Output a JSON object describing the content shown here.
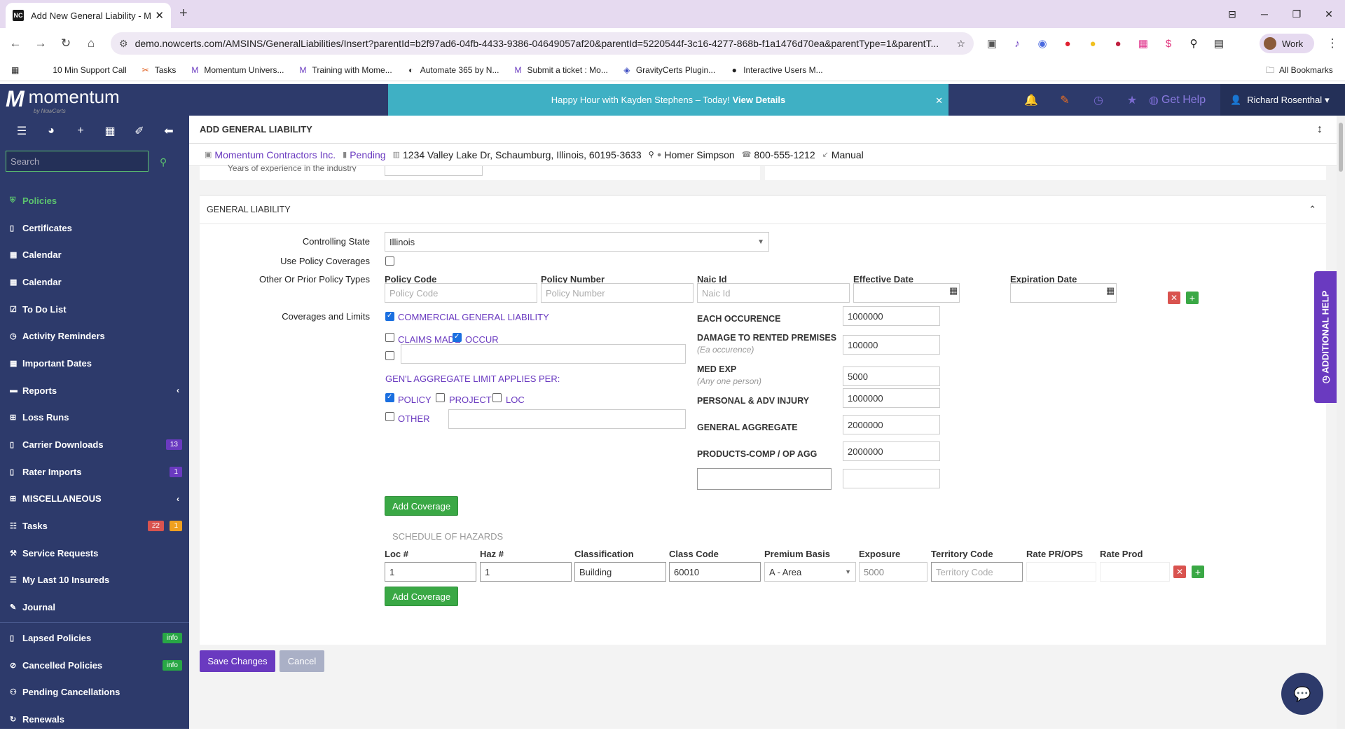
{
  "browser": {
    "tab_title": "Add New General Liability - Mo",
    "tab_icon": "NC",
    "url": "demo.nowcerts.com/AMSINS/GeneralLiabilities/Insert?parentId=b2f97ad6-04fb-4433-9386-04649057af20&parentId=5220544f-3c16-4277-868b-f1a1476d70ea&parentType=1&parentT...",
    "profile_label": "Work",
    "bookmarks": [
      "10 Min Support Call",
      "Tasks",
      "Momentum Univers...",
      "Training with Mome...",
      "Automate 365 by N...",
      "Submit a ticket : Mo...",
      "GravityCerts Plugin...",
      "Interactive Users M..."
    ],
    "all_bookmarks": "All Bookmarks"
  },
  "header": {
    "logo_text": "momentum",
    "logo_sub": "by NowCerts",
    "promo_text": "Happy Hour with Kayden Stephens – Today!",
    "promo_link": "View Details",
    "get_help": "Get Help",
    "user_name": "Richard Rosenthal"
  },
  "sidebar": {
    "search_placeholder": "Search",
    "items": [
      {
        "label": "Policies",
        "icon": "shield-icon",
        "active": true
      },
      {
        "label": "Certificates",
        "icon": "file-icon"
      },
      {
        "label": "Calendar",
        "icon": "calendar-icon"
      },
      {
        "label": "Calendar",
        "icon": "calendar-icon"
      },
      {
        "label": "To Do List",
        "icon": "checklist-icon"
      },
      {
        "label": "Activity Reminders",
        "icon": "clock-icon"
      },
      {
        "label": "Important Dates",
        "icon": "calendar-icon"
      },
      {
        "label": "Reports",
        "icon": "folder-icon"
      },
      {
        "label": "Loss Runs",
        "icon": "grid-icon"
      },
      {
        "label": "Carrier Downloads",
        "icon": "file-icon",
        "badge": "13"
      },
      {
        "label": "Rater Imports",
        "icon": "file-icon",
        "badge": "1"
      },
      {
        "label": "MISCELLANEOUS",
        "icon": "grid-icon"
      },
      {
        "label": "Tasks",
        "icon": "tasks-icon",
        "badge_red": "22",
        "badge_orange": "1"
      },
      {
        "label": "Service Requests",
        "icon": "wrench-icon"
      },
      {
        "label": "My Last 10 Insureds",
        "icon": "list-icon"
      },
      {
        "label": "Journal",
        "icon": "pencil-icon"
      },
      {
        "label": "Lapsed Policies",
        "icon": "file-icon",
        "badge_info": "info"
      },
      {
        "label": "Cancelled Policies",
        "icon": "ban-icon",
        "badge_info": "info"
      },
      {
        "label": "Pending Cancellations",
        "icon": "users-icon"
      },
      {
        "label": "Renewals",
        "icon": "refresh-icon"
      }
    ]
  },
  "page": {
    "title": "ADD GENERAL LIABILITY",
    "insured": "Momentum Contractors Inc.",
    "status": "Pending",
    "address": "1234 Valley Lake Dr, Schaumburg, Illinois, 60195-3633",
    "contact": "Homer Simpson",
    "phone": "800-555-1212",
    "source": "Manual",
    "prev_label": "Years of experience in the industry"
  },
  "gl": {
    "section_title": "GENERAL LIABILITY",
    "controlling_state_label": "Controlling State",
    "controlling_state": "Illinois",
    "use_policy_coverages_label": "Use Policy Coverages",
    "other_prior_label": "Other Or Prior Policy Types",
    "policy_code_label": "Policy Code",
    "policy_code_ph": "Policy Code",
    "policy_number_label": "Policy Number",
    "policy_number_ph": "Policy Number",
    "naic_label": "Naic Id",
    "naic_ph": "Naic Id",
    "eff_date_label": "Effective Date",
    "exp_date_label": "Expiration Date",
    "coverages_label": "Coverages and Limits",
    "cgl": "COMMERCIAL GENERAL LIABILITY",
    "claims_made": "CLAIMS MADE",
    "occur": "OCCUR",
    "agg_applies": "GEN'L AGGREGATE LIMIT APPLIES PER:",
    "policy": "POLICY",
    "project": "PROJECT",
    "loc": "LOC",
    "other": "OTHER",
    "each_occ": "EACH OCCURENCE",
    "each_occ_val": "1000000",
    "damage": "DAMAGE TO RENTED PREMISES",
    "damage_sub": "(Ea occurence)",
    "damage_val": "100000",
    "med": "MED EXP",
    "med_sub": "(Any one person)",
    "med_val": "5000",
    "personal": "PERSONAL & ADV INJURY",
    "personal_val": "1000000",
    "gen_agg": "GENERAL AGGREGATE",
    "gen_agg_val": "2000000",
    "products": "PRODUCTS-COMP / OP AGG",
    "products_val": "2000000",
    "add_coverage": "Add Coverage",
    "hazards_title": "SCHEDULE OF HAZARDS",
    "hz_loc": "Loc #",
    "hz_haz": "Haz #",
    "hz_class": "Classification",
    "hz_code": "Class Code",
    "hz_basis": "Premium Basis",
    "hz_exposure": "Exposure",
    "hz_territory": "Territory Code",
    "hz_rate_ops": "Rate PR/OPS",
    "hz_rate_prod": "Rate Prod",
    "row": {
      "loc": "1",
      "haz": "1",
      "class": "Building",
      "code": "60010",
      "basis": "A - Area",
      "exposure": "5000",
      "territory_ph": "Territory Code"
    }
  },
  "footer": {
    "save": "Save Changes",
    "cancel": "Cancel"
  },
  "help_tab": "ADDITIONAL HELP"
}
